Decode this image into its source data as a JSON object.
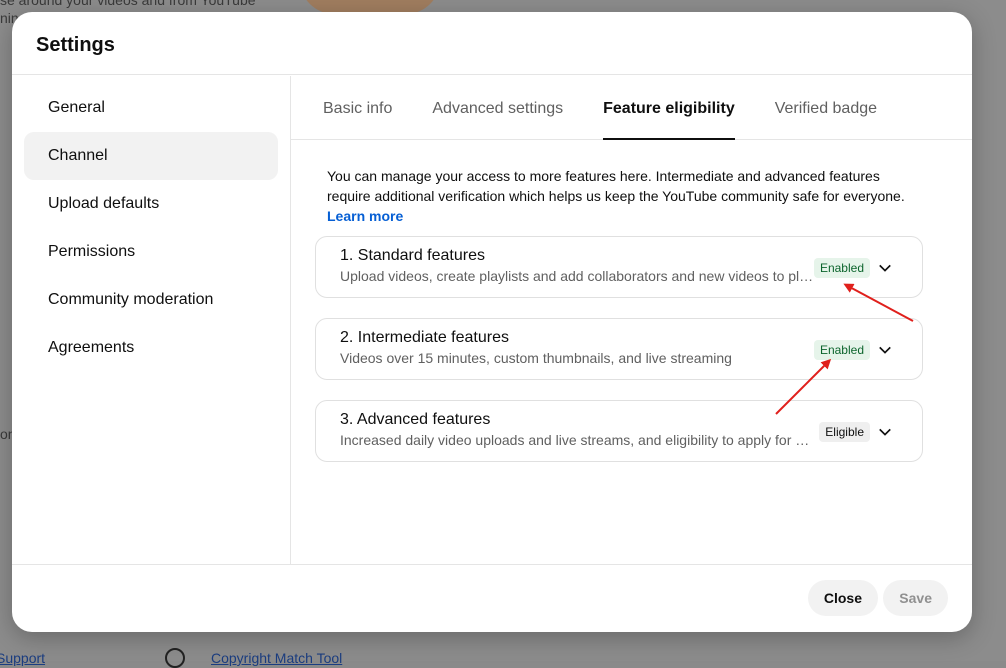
{
  "background": {
    "text_line1": "se around your videos and from YouTube",
    "text_line2": "nin",
    "text_line3": "on",
    "support_link": "Support",
    "copyright_link": "Copyright Match Tool"
  },
  "dialog": {
    "title": "Settings"
  },
  "sidebar": {
    "items": [
      {
        "label": "General"
      },
      {
        "label": "Channel"
      },
      {
        "label": "Upload defaults"
      },
      {
        "label": "Permissions"
      },
      {
        "label": "Community moderation"
      },
      {
        "label": "Agreements"
      }
    ],
    "active": "Channel"
  },
  "tabs": [
    {
      "label": "Basic info"
    },
    {
      "label": "Advanced settings"
    },
    {
      "label": "Feature eligibility"
    },
    {
      "label": "Verified badge"
    }
  ],
  "active_tab": "Feature eligibility",
  "intro": {
    "text": "You can manage your access to more features here. Intermediate and advanced features require additional verification which helps us keep the YouTube community safe for everyone.",
    "learn_more": "Learn more"
  },
  "features": [
    {
      "title": "1. Standard features",
      "description": "Upload videos, create playlists and add collaborators and new videos to playlists",
      "status": "Enabled"
    },
    {
      "title": "2. Intermediate features",
      "description": "Videos over 15 minutes, custom thumbnails, and live streaming",
      "status": "Enabled"
    },
    {
      "title": "3. Advanced features",
      "description": "Increased daily video uploads and live streams, and eligibility to apply for monetization",
      "status": "Eligible"
    }
  ],
  "footer": {
    "close_label": "Close",
    "save_label": "Save"
  },
  "colors": {
    "enabled_badge_bg": "#e6f4ea",
    "enabled_badge_text": "#0d652d",
    "link": "#065fd4",
    "annotation_arrow": "#e0201c"
  },
  "icons": {
    "expand": "chevron-down-icon",
    "copyright": "copyright-icon"
  }
}
